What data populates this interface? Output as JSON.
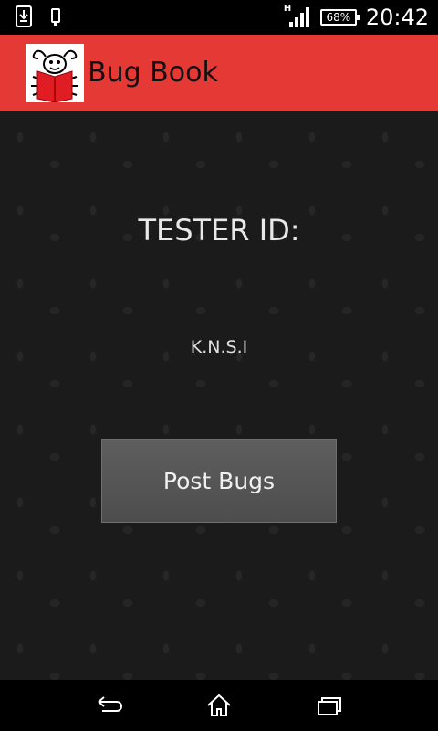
{
  "status_bar": {
    "time": "20:42",
    "battery": "68%",
    "network_type": "H",
    "icons": [
      "download-icon",
      "phone-icon",
      "signal-icon",
      "battery-icon"
    ]
  },
  "app_bar": {
    "title": "Bug Book",
    "logo_icon": "bug-reading-book-logo",
    "color": "#e53935"
  },
  "main": {
    "tester_label": "TESTER ID:",
    "tester_value": "K.N.S.I",
    "post_button_label": "Post Bugs"
  },
  "nav_bar": {
    "buttons": [
      "back-icon",
      "home-icon",
      "recent-apps-icon"
    ]
  }
}
